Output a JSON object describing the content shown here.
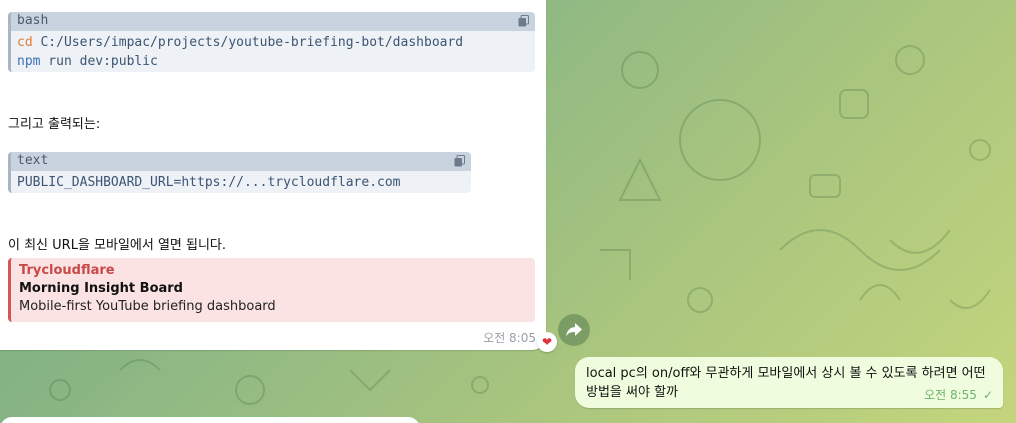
{
  "chat": {
    "incoming": {
      "code1": {
        "lang": "bash",
        "line1_cmd": "cd",
        "line1_rest": " C:/Users/impac/projects/youtube-briefing-bot/dashboard",
        "line2_cmd": "npm",
        "line2_rest": " run dev:public"
      },
      "text1": "그리고 출력되는:",
      "code2": {
        "lang": "text",
        "line1": "PUBLIC_DASHBOARD_URL=https://...trycloudflare.com"
      },
      "text2": "이 최신 URL을 모바일에서 열면 됩니다.",
      "link_preview": {
        "site": "Trycloudflare",
        "title": "Morning Insight Board",
        "description": "Mobile-first YouTube briefing dashboard"
      },
      "time": "오전 8:05",
      "reaction": "❤"
    },
    "outgoing": {
      "text": "local pc의 on/off와 무관하게 모바일에서 상시 볼 수 있도록 하려면 어떤 방법을 써야 할까",
      "time": "오전 8:55",
      "status": "✓"
    }
  },
  "colors": {
    "accent_link": "#c94848",
    "outgoing_bg": "#effdde",
    "code_keyword_orange": "#e07b39",
    "code_keyword_blue": "#3d6fb6"
  },
  "icons": [
    "copy-icon",
    "forward-icon",
    "heart-reaction-icon",
    "read-check-icon"
  ]
}
